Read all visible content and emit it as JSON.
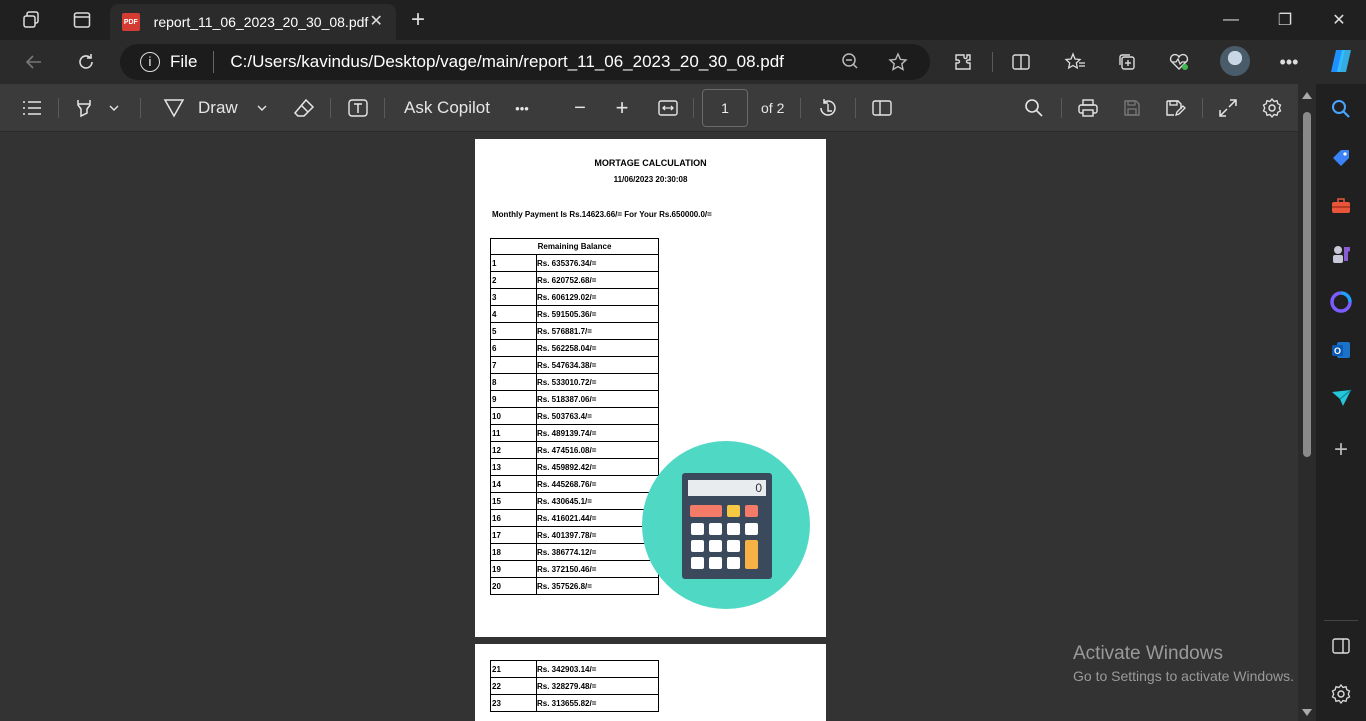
{
  "tab": {
    "title": "report_11_06_2023_20_30_08.pdf",
    "close": "✕",
    "pdf_badge": "PDF"
  },
  "window": {
    "minimize": "—",
    "restore": "❐",
    "close": "✕",
    "new_tab": "+"
  },
  "address": {
    "scheme_label": "File",
    "info": "i",
    "url": "C:/Users/kavindus/Desktop/vage/main/report_11_06_2023_20_30_08.pdf"
  },
  "toolbar": {
    "draw_label": "Draw",
    "ask_copilot": "Ask Copilot",
    "more": "•••",
    "zoom_out": "−",
    "zoom_in": "+",
    "page_number": "1",
    "page_total": "of 2"
  },
  "report": {
    "title": "MORTAGE CALCULATION",
    "datetime": "11/06/2023   20:30:08",
    "monthly_payment": "Monthly Payment Is Rs.14623.66/= For Your Rs.650000.0/=",
    "table_header": "Remaining Balance",
    "rows_page1": [
      {
        "n": "1",
        "v": "Rs. 635376.34/="
      },
      {
        "n": "2",
        "v": "Rs. 620752.68/="
      },
      {
        "n": "3",
        "v": "Rs. 606129.02/="
      },
      {
        "n": "4",
        "v": "Rs. 591505.36/="
      },
      {
        "n": "5",
        "v": "Rs. 576881.7/="
      },
      {
        "n": "6",
        "v": "Rs. 562258.04/="
      },
      {
        "n": "7",
        "v": "Rs. 547634.38/="
      },
      {
        "n": "8",
        "v": "Rs. 533010.72/="
      },
      {
        "n": "9",
        "v": "Rs. 518387.06/="
      },
      {
        "n": "10",
        "v": "Rs. 503763.4/="
      },
      {
        "n": "11",
        "v": "Rs. 489139.74/="
      },
      {
        "n": "12",
        "v": "Rs. 474516.08/="
      },
      {
        "n": "13",
        "v": "Rs. 459892.42/="
      },
      {
        "n": "14",
        "v": "Rs. 445268.76/="
      },
      {
        "n": "15",
        "v": "Rs. 430645.1/="
      },
      {
        "n": "16",
        "v": "Rs. 416021.44/="
      },
      {
        "n": "17",
        "v": "Rs. 401397.78/="
      },
      {
        "n": "18",
        "v": "Rs. 386774.12/="
      },
      {
        "n": "19",
        "v": "Rs. 372150.46/="
      },
      {
        "n": "20",
        "v": "Rs. 357526.8/="
      }
    ],
    "rows_page2": [
      {
        "n": "21",
        "v": "Rs. 342903.14/="
      },
      {
        "n": "22",
        "v": "Rs. 328279.48/="
      },
      {
        "n": "23",
        "v": "Rs. 313655.82/="
      }
    ],
    "calculator_display": "0"
  },
  "watermark": {
    "line1": "Activate Windows",
    "line2": "Go to Settings to activate Windows."
  },
  "colors": {
    "accent_calc_bg": "#4fd9c5",
    "pdf_badge": "#d43b33"
  }
}
